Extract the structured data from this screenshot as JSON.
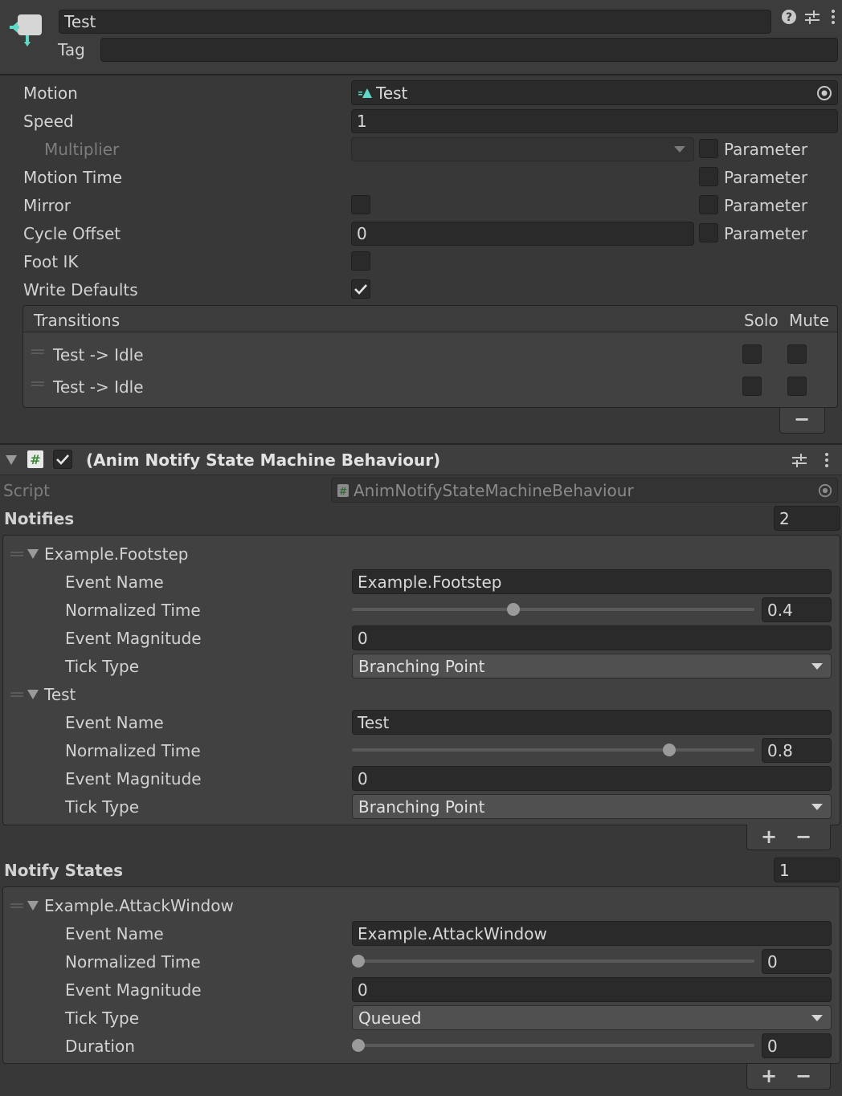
{
  "header": {
    "name": "Test",
    "tag_label": "Tag",
    "tag_value": ""
  },
  "state": {
    "motion_label": "Motion",
    "motion_value": "Test",
    "speed_label": "Speed",
    "speed_value": "1",
    "multiplier_label": "Multiplier",
    "multiplier_value": "",
    "motion_time_label": "Motion Time",
    "mirror_label": "Mirror",
    "cycle_offset_label": "Cycle Offset",
    "cycle_offset_value": "0",
    "foot_ik_label": "Foot IK",
    "write_defaults_label": "Write Defaults",
    "write_defaults_checked": true,
    "parameter_label": "Parameter"
  },
  "transitions": {
    "title": "Transitions",
    "solo_label": "Solo",
    "mute_label": "Mute",
    "rows": [
      {
        "label": "Test -> Idle"
      },
      {
        "label": "Test -> Idle"
      }
    ]
  },
  "component": {
    "title": "(Anim Notify State Machine Behaviour)",
    "enabled": true,
    "script_label": "Script",
    "script_value": "AnimNotifyStateMachineBehaviour"
  },
  "notifies": {
    "title": "Notifies",
    "count": "2",
    "items": [
      {
        "header": "Example.Footstep",
        "event_name": "Example.Footstep",
        "normalized_time": "0.4",
        "event_magnitude": "0",
        "tick_type": "Branching Point"
      },
      {
        "header": "Test",
        "event_name": "Test",
        "normalized_time": "0.8",
        "event_magnitude": "0",
        "tick_type": "Branching Point"
      }
    ]
  },
  "notify_states": {
    "title": "Notify States",
    "count": "1",
    "items": [
      {
        "header": "Example.AttackWindow",
        "event_name": "Example.AttackWindow",
        "normalized_time": "0",
        "event_magnitude": "0",
        "tick_type": "Queued",
        "duration": "0"
      }
    ]
  },
  "labels": {
    "event_name": "Event Name",
    "normalized_time": "Normalized Time",
    "event_magnitude": "Event Magnitude",
    "tick_type": "Tick Type",
    "duration": "Duration"
  },
  "buttons": {
    "add": "+",
    "remove": "−"
  },
  "icons": {
    "state_icon": "animator-state-icon",
    "help": "help-icon",
    "presets": "presets-icon",
    "menu": "kebab-menu-icon",
    "object_picker": "object-picker-icon",
    "anim_clip": "animation-clip-icon",
    "script": "csharp-script-icon"
  },
  "colors": {
    "accent_teal": "#5fd8c8",
    "background": "#383838",
    "field": "#2a2a2a"
  }
}
